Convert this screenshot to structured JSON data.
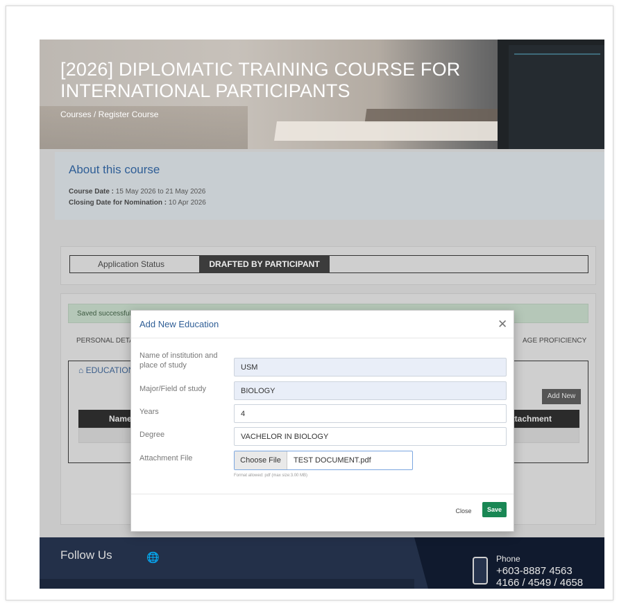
{
  "hero": {
    "title": "[2026] DIPLOMATIC TRAINING COURSE FOR INTERNATIONAL PARTICIPANTS",
    "breadcrumb": "Courses / Register Course"
  },
  "about": {
    "heading": "About this course",
    "course_date_label": "Course Date :",
    "course_date_value": "15 May 2026 to 21 May 2026",
    "closing_label": "Closing Date for Nomination :",
    "closing_value": "10 Apr 2026"
  },
  "application": {
    "status_label": "Application Status",
    "status_value": "DRAFTED BY PARTICIPANT"
  },
  "form_card": {
    "alert": "Saved successfully.",
    "tab_left": "PERSONAL DETAIL",
    "tab_right": "AGE PROFICIENCY",
    "section_title": "EDUCATION",
    "section_icon": "user-icon",
    "add_new_label": "Add New",
    "table_headers": [
      "Name o",
      "Attachment"
    ]
  },
  "modal": {
    "title": "Add New Education",
    "close_icon": "close-icon",
    "fields": {
      "institution_label": "Name of institution and place of study",
      "institution_value": "USM",
      "major_label": "Major/Field of study",
      "major_value": "BIOLOGY",
      "years_label": "Years",
      "years_value": "4",
      "degree_label": "Degree",
      "degree_value": "VACHELOR IN BIOLOGY",
      "attachment_label": "Attachment File",
      "choose_file_label": "Choose File",
      "file_name": "TEST DOCUMENT.pdf",
      "file_hint": "Format allowed: pdf (max size:3.00 MB)"
    },
    "close_button": "Close",
    "save_button": "Save"
  },
  "footer": {
    "follow_us": "Follow Us",
    "globe_icon": "globe-icon",
    "phone_label": "Phone",
    "phone_number": "+603-8887 4563",
    "phone_ext": "4166 / 4549 / 4658"
  },
  "colors": {
    "accent_blue": "#2f5e96",
    "save_green": "#198754",
    "footer_navy": "#233049"
  }
}
